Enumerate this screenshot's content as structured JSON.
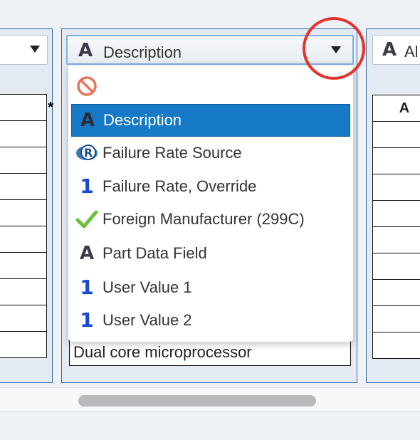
{
  "left_column": {
    "select_value": "",
    "header_fragment": "*"
  },
  "middle_column": {
    "select": {
      "icon": "text-field-icon",
      "value": "Description"
    },
    "dropdown": {
      "items": [
        {
          "icon": "none-icon",
          "label": "",
          "selected": false
        },
        {
          "icon": "text-field-icon",
          "label": "Description",
          "selected": true
        },
        {
          "icon": "failure-rate-source-icon",
          "label": "Failure Rate Source",
          "selected": false
        },
        {
          "icon": "numeric-field-icon",
          "label": "Failure Rate, Override",
          "selected": false
        },
        {
          "icon": "checkmark-icon",
          "label": "Foreign Manufacturer (299C)",
          "selected": false
        },
        {
          "icon": "text-field-icon",
          "label": "Part Data Field",
          "selected": false
        },
        {
          "icon": "numeric-field-icon",
          "label": "User Value 1",
          "selected": false
        },
        {
          "icon": "numeric-field-icon",
          "label": "User Value 2",
          "selected": false
        }
      ]
    },
    "cell_value": "Dual core microprocessor"
  },
  "right_column": {
    "select": {
      "icon": "text-field-icon",
      "value_fragment": "Al"
    },
    "header_fragment": "A"
  },
  "colors": {
    "selection": "#1679c5",
    "annotation": "#e5322d",
    "panel_border": "#2e6a9e"
  }
}
